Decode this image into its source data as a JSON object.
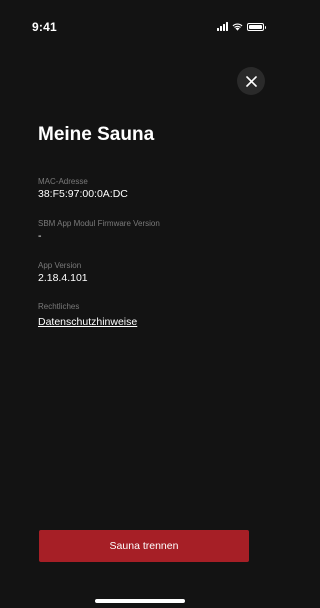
{
  "status_bar": {
    "time": "9:41",
    "icons": [
      "signal-icon",
      "wifi-icon",
      "battery-icon"
    ]
  },
  "colors": {
    "background": "#131313",
    "accent": "#a61f26",
    "label": "#7a7a7a",
    "text": "#ffffff"
  },
  "page": {
    "title": "Meine Sauna"
  },
  "info": {
    "mac_label": "MAC-Adresse",
    "mac_value": "38:F5:97:00:0A:DC",
    "firmware_label": "SBM App Modul Firmware Version",
    "firmware_value": "-",
    "app_label": "App Version",
    "app_value": "2.18.4.101",
    "legal_label": "Rechtliches",
    "legal_link": "Datenschutzhinweise"
  },
  "actions": {
    "close_icon": "close-icon",
    "disconnect_label": "Sauna trennen"
  }
}
